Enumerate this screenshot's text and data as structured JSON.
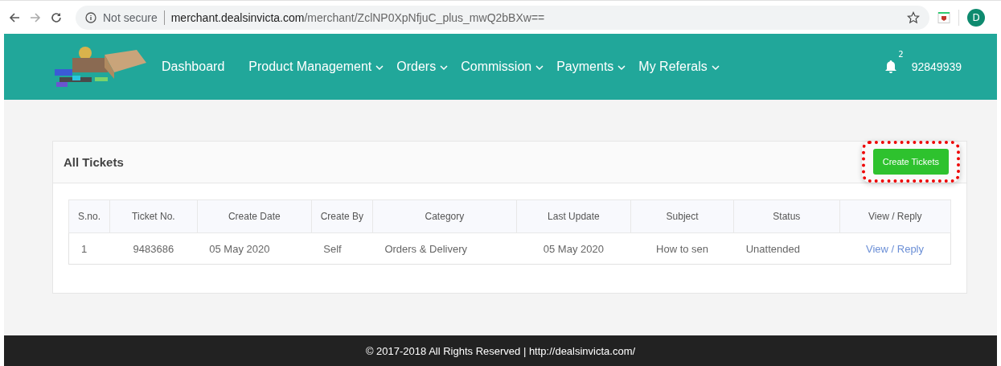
{
  "browser": {
    "security": "Not secure",
    "url_host": "merchant.dealsinvicta.com",
    "url_path": "/merchant/ZclNP0XpNfjuC_plus_mwQ2bBXw==",
    "profile_initial": "D"
  },
  "nav": {
    "items": [
      {
        "label": "Dashboard",
        "dropdown": false
      },
      {
        "label": "Product Management",
        "dropdown": true
      },
      {
        "label": "Orders",
        "dropdown": true
      },
      {
        "label": "Commission",
        "dropdown": true
      },
      {
        "label": "Payments",
        "dropdown": true
      },
      {
        "label": "My Referals",
        "dropdown": true
      }
    ],
    "notification_count": "2",
    "user": "92849939"
  },
  "panel": {
    "title": "All Tickets",
    "create_button": {
      "label": "Create Tickets",
      "highlighted": true
    },
    "table": {
      "columns": [
        "S.no.",
        "Ticket No.",
        "Create Date",
        "Create By",
        "Category",
        "Last Update",
        "Subject",
        "Status",
        "View / Reply"
      ],
      "rows": [
        {
          "cells": [
            "1",
            "9483686",
            "05 May 2020",
            "Self",
            "Orders & Delivery",
            "05 May 2020",
            "How to sen",
            "Unattended"
          ],
          "action": "View / Reply"
        }
      ]
    }
  },
  "footer": {
    "text": "© 2017-2018 All Rights Reserved | http://dealsinvicta.com/"
  }
}
